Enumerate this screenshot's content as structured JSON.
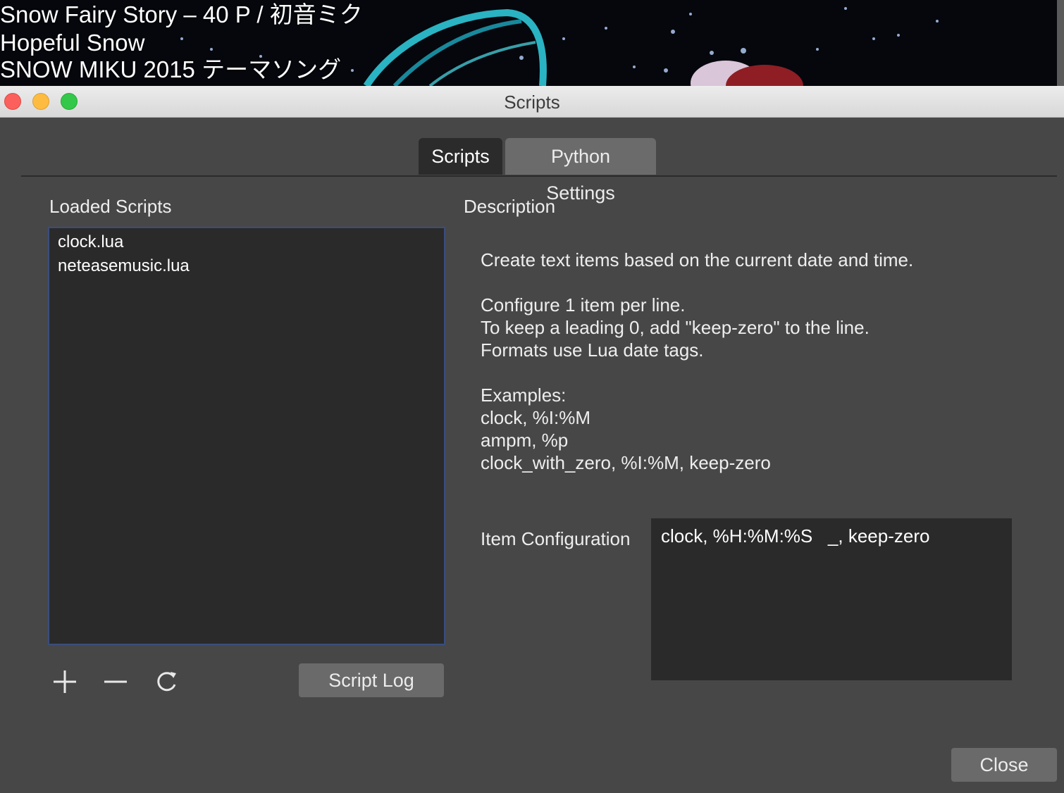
{
  "background": {
    "lines": [
      "Snow Fairy Story –  40   P / 初音ミク",
      "Hopeful Snow",
      "SNOW MIKU 2015 テーマソング"
    ]
  },
  "window": {
    "title": "Scripts"
  },
  "tabs": [
    {
      "label": "Scripts",
      "active": true
    },
    {
      "label": "Python Settings",
      "active": false
    }
  ],
  "loaded_scripts": {
    "heading": "Loaded Scripts",
    "items": [
      "clock.lua",
      "neteasemusic.lua"
    ]
  },
  "toolbar": {
    "add_icon": "plus-icon",
    "remove_icon": "minus-icon",
    "reload_icon": "reload-icon",
    "script_log_label": "Script Log"
  },
  "description": {
    "heading": "Description",
    "lines": [
      "Create text items based on the current date and time.",
      "Configure 1 item per line.",
      "To keep a leading 0, add \"keep-zero\" to the line.",
      "Formats use Lua date tags.",
      "Examples:",
      "clock, %I:%M",
      "ampm, %p",
      "clock_with_zero, %I:%M, keep-zero"
    ]
  },
  "item_configuration": {
    "label": "Item Configuration",
    "value": "clock, %H:%M:%S   _, keep-zero"
  },
  "close_label": "Close",
  "colors": {
    "window_bg": "#474747",
    "list_bg": "#2a2a2a",
    "list_focus_border": "#3a4e7c",
    "button_bg": "#6a6a6a"
  }
}
